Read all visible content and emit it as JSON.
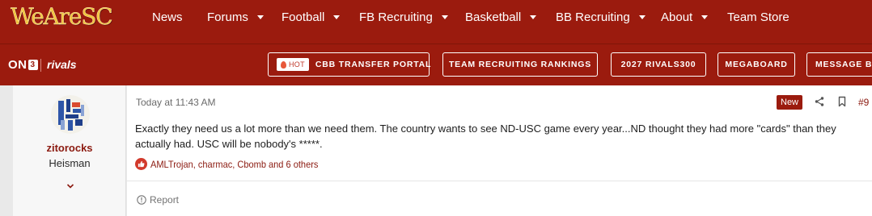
{
  "site": {
    "logo_text": "WeAreSC"
  },
  "nav": {
    "items": [
      {
        "label": "News",
        "has_dropdown": false
      },
      {
        "label": "Forums",
        "has_dropdown": true
      },
      {
        "label": "Football",
        "has_dropdown": true
      },
      {
        "label": "FB Recruiting",
        "has_dropdown": true
      },
      {
        "label": "Basketball",
        "has_dropdown": true
      },
      {
        "label": "BB Recruiting",
        "has_dropdown": true
      },
      {
        "label": "About",
        "has_dropdown": true
      },
      {
        "label": "Team Store",
        "has_dropdown": false
      }
    ]
  },
  "partner_bar": {
    "on3_text": "ON",
    "on3_digit": "3",
    "rivals_text": "rivals",
    "hot_badge": "HOT",
    "pills": [
      {
        "label": "CBB TRANSFER PORTAL"
      },
      {
        "label": "TEAM RECRUITING RANKINGS"
      },
      {
        "label": "2027 RIVALS300"
      },
      {
        "label": "MEGABOARD"
      },
      {
        "label": "MESSAGE B"
      }
    ]
  },
  "post": {
    "user": {
      "name": "zitorocks",
      "title": "Heisman"
    },
    "timestamp": "Today at 11:43 AM",
    "new_badge": "New",
    "post_number": "#9",
    "message": "Exactly they need us a lot more than we need them. The country wants to see ND-USC game every year...ND thought they had more \"cards\" than they actually had. USC will be nobody's *****.",
    "reactions_text": "AMLTrojan, charmac, Cbomb and 6 others",
    "report_label": "Report"
  },
  "colors": {
    "brand": "#9b1b0e",
    "logo_gold": "#f2c53d",
    "link": "#8b1a10",
    "like": "#d23a2c"
  }
}
